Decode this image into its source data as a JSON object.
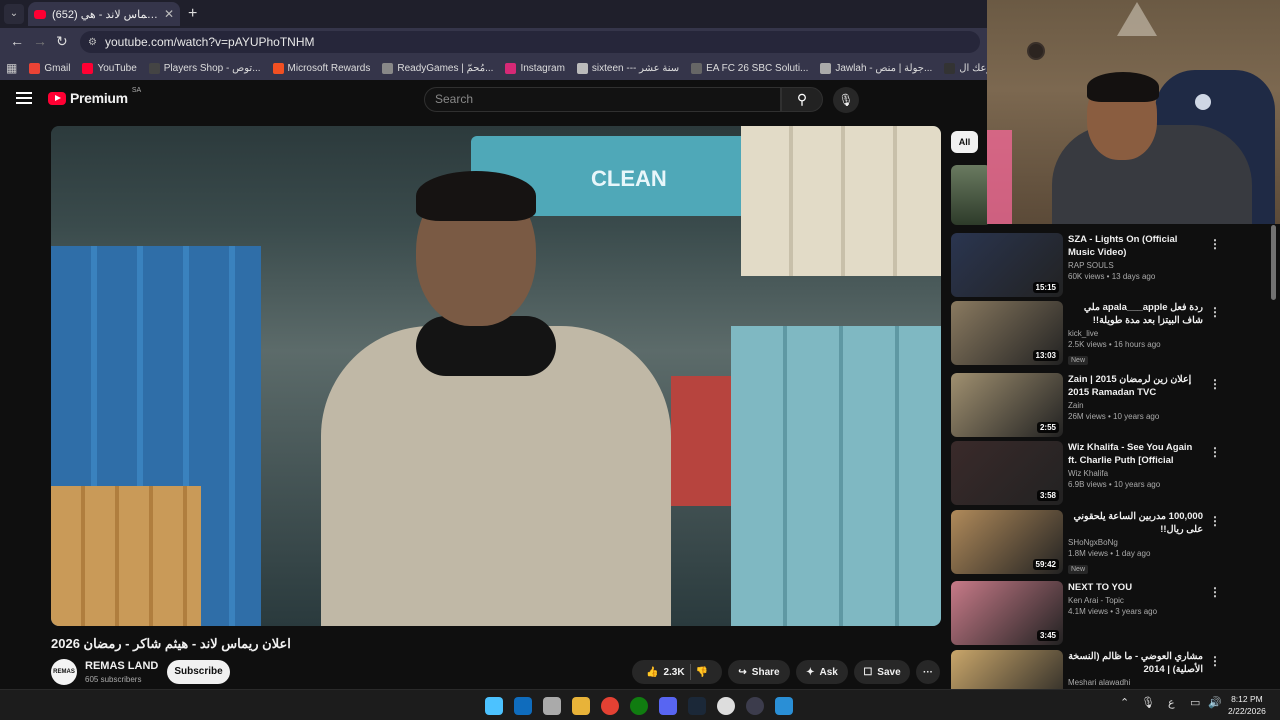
{
  "browser": {
    "tab_title": "(652) اعلان ريماس لاند - هي...",
    "url": "youtube.com/watch?v=pAYUPhoTNHM",
    "bookmarks": [
      {
        "label": "Gmail",
        "color": "#ea4335"
      },
      {
        "label": "YouTube",
        "color": "#ff0033"
      },
      {
        "label": "Players Shop - توص...",
        "color": "#444"
      },
      {
        "label": "Microsoft Rewards",
        "color": "#f25022"
      },
      {
        "label": "ReadyGames | مُحمّ...",
        "color": "#888"
      },
      {
        "label": "Instagram",
        "color": "#d62976"
      },
      {
        "label": "sixteen --- سنة عشر",
        "color": "#bbb"
      },
      {
        "label": "EA FC 26 SBC Soluti...",
        "color": "#666"
      },
      {
        "label": "Jawlah - جولة | منص...",
        "color": "#aaa"
      },
      {
        "label": "أطلق مشروعك ال...",
        "color": "#333"
      }
    ]
  },
  "masthead": {
    "brand": "Premium",
    "country": "SA",
    "search_placeholder": "Search"
  },
  "video": {
    "title": "اعلان ريماس لاند - هيثم شاكر - رمضان 2026",
    "frame_sign": "CLEAN",
    "channel": "REMAS LAND",
    "subscribers": "605 subscribers",
    "subscribe_label": "Subscribe",
    "likes": "2.3K",
    "share_label": "Share",
    "ask_label": "Ask",
    "save_label": "Save"
  },
  "sidebar": {
    "chip_all": "All",
    "recommendations": [
      {
        "title": "SZA - Lights On (Official Music Video)",
        "channel": "RAP SOULS",
        "stats": "60K views • 13 days ago",
        "duration": "15:15",
        "new": "",
        "thumb": "#2a3550"
      },
      {
        "title": "ردة فعل apala___apple ملي شاف البيتزا بعد مدة طويلة!!",
        "channel": "kick_live",
        "stats": "2.5K views • 16 hours ago",
        "duration": "13:03",
        "new": "New",
        "thumb": "#8a7a60"
      },
      {
        "title": "Zain | 2015 إعلان زين لرمضان 2015 Ramadan TVC",
        "channel": "Zain",
        "stats": "26M views • 10 years ago",
        "duration": "2:55",
        "new": "",
        "thumb": "#a09070"
      },
      {
        "title": "Wiz Khalifa - See You Again ft. Charlie Puth [Official Video] ...",
        "channel": "Wiz Khalifa",
        "stats": "6.9B views • 10 years ago",
        "duration": "3:58",
        "new": "",
        "thumb": "#3a2a2a"
      },
      {
        "title": "100,000 مدربين الساعة يلحقوني على ريال!!",
        "channel": "SHoNgxBoNg",
        "stats": "1.8M views • 1 day ago",
        "duration": "59:42",
        "new": "New",
        "thumb": "#b08a5a"
      },
      {
        "title": "NEXT TO YOU",
        "channel": "Ken Arai - Topic",
        "stats": "4.1M views • 3 years ago",
        "duration": "3:45",
        "new": "",
        "thumb": "#c77a88"
      },
      {
        "title": "مشاري العوضي - ما ظالم (النسخة الأصلية) | 2014",
        "channel": "Meshari alawadhi",
        "stats": "",
        "duration": "",
        "new": "",
        "thumb": "#c9a66a"
      }
    ]
  },
  "taskbar": {
    "time": "8:12 PM",
    "date": "2/22/2026",
    "lang": "ع"
  }
}
